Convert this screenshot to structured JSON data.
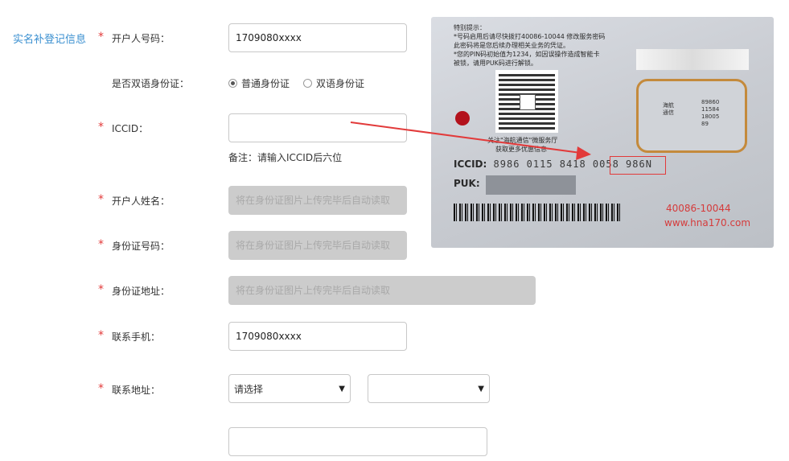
{
  "section_title": "实名补登记信息",
  "required_mark": "*",
  "fields": {
    "phone_number": {
      "label": "开户人号码：",
      "value": "1709080xxxx"
    },
    "bilingual_id": {
      "label": "是否双语身份证：",
      "options": [
        {
          "label": "普通身份证",
          "checked": true
        },
        {
          "label": "双语身份证",
          "checked": false
        }
      ]
    },
    "iccid": {
      "label": "ICCID：",
      "value": "",
      "note": "备注：请输入ICCID后六位"
    },
    "owner_name": {
      "label": "开户人姓名：",
      "placeholder": "将在身份证图片上传完毕后自动读取"
    },
    "id_number": {
      "label": "身份证号码：",
      "placeholder": "将在身份证图片上传完毕后自动读取"
    },
    "id_address": {
      "label": "身份证地址：",
      "placeholder": "将在身份证图片上传完毕后自动读取"
    },
    "contact_phone": {
      "label": "联系手机：",
      "value": "1709080xxxx"
    },
    "contact_address": {
      "label": "联系地址：",
      "province_select": "请选择",
      "city_select": "",
      "detail_value": ""
    }
  },
  "card_image": {
    "tips": [
      "特别提示：",
      "*号码启用后请尽快拨打40086-10044 修改服务密码",
      "此密码将是您后续办理相关业务的凭证。",
      "*您的PIN码初始值为1234，如因误操作造成智能卡",
      "被锁，请用PUK码进行解锁。"
    ],
    "qr_caption_1": "关注\"海航通信\"微服务厅",
    "qr_caption_2": "获取更多优惠信息",
    "sim_brand": "海航\n通信",
    "sim_digits": "89860\n11584\n18005\n89",
    "iccid_label": "ICCID:",
    "iccid_number": "8986 0115 8418 0058 986N",
    "puk_label": "PUK:",
    "hotline": "40086-10044",
    "website": "www.hna170.com"
  },
  "colors": {
    "accent": "#3a8fd0",
    "required": "#e23a3a",
    "disabled_bg": "#cccccc",
    "card_red": "#d53b3b"
  }
}
